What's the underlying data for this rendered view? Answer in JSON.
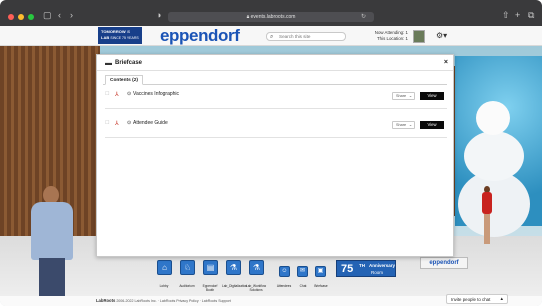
{
  "browser": {
    "url": "events.labroots.com",
    "lock_icon": "lock-icon",
    "traffic_lights": [
      "#ff5f57",
      "#febc2e",
      "#28c840"
    ]
  },
  "header": {
    "badge_line1": "TOMORROW",
    "badge_line2": "IS",
    "badge_line3": "LAB",
    "badge_line4": "SINCE 75 YEARS",
    "logo": "eppendorf",
    "search_placeholder": "Search this site",
    "now_attending": "Now Attending: 1",
    "this_location": "This Location: 1"
  },
  "modal": {
    "title": "Briefcase",
    "tab_label": "Contents (2)",
    "items": [
      {
        "name": "Vaccines Infographic",
        "share": "Share",
        "view": "View"
      },
      {
        "name": "Attendee Guide",
        "share": "Share",
        "view": "View"
      }
    ]
  },
  "dock": {
    "items": [
      {
        "label": "Lobby"
      },
      {
        "label": "Auditorium"
      },
      {
        "label": "Eppendorf Booth"
      },
      {
        "label": "Lab_Digitalization"
      },
      {
        "label": "Lab_Workflow Solutions"
      },
      {
        "label": "Attendees"
      },
      {
        "label": "Chat"
      },
      {
        "label": "Briefcase"
      }
    ],
    "anniversary_number": "75",
    "anniversary_sup": "TH",
    "anniversary_line1": "Anniversary",
    "anniversary_line2": "Room"
  },
  "scene": {
    "booth_sign": "eppendorf"
  },
  "footer": {
    "brand": "LabRoots",
    "copyright": "2006-2022 LabRoots Inc. · LabRoots Privacy Policy · LabRoots Support",
    "chat_invite": "Invite people to chat"
  },
  "colors": {
    "brand_blue": "#1b54b6",
    "dock_blue": "#2f76c9",
    "view_button": "#0a0a0a"
  }
}
